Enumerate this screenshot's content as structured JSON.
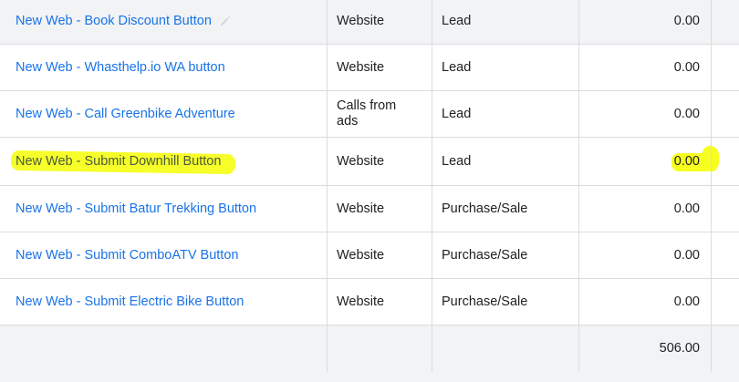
{
  "rows": [
    {
      "name": "New Web - Book Discount Button",
      "source": "Website",
      "category": "Lead",
      "value": "0.00",
      "edit_icon": "pencil-icon"
    },
    {
      "name": "New Web - Whasthelp.io WA button",
      "source": "Website",
      "category": "Lead",
      "value": "0.00"
    },
    {
      "name": "New Web - Call Greenbike Adventure",
      "source": "Calls from ads",
      "category": "Lead",
      "value": "0.00"
    },
    {
      "name": "New Web - Submit Downhill Button",
      "source": "Website",
      "category": "Lead",
      "value": "0.00",
      "highlighted": true
    },
    {
      "name": "New Web - Submit Batur Trekking Button",
      "source": "Website",
      "category": "Purchase/Sale",
      "value": "0.00"
    },
    {
      "name": "New Web - Submit ComboATV Button",
      "source": "Website",
      "category": "Purchase/Sale",
      "value": "0.00"
    },
    {
      "name": "New Web - Submit Electric Bike Button",
      "source": "Website",
      "category": "Purchase/Sale",
      "value": "0.00"
    }
  ],
  "total": {
    "value": "506.00"
  },
  "colors": {
    "link": "#1a73e8",
    "highlight": "#f7ff1f",
    "row_bg_alt": "#f1f3f4",
    "border": "#dadce0"
  }
}
